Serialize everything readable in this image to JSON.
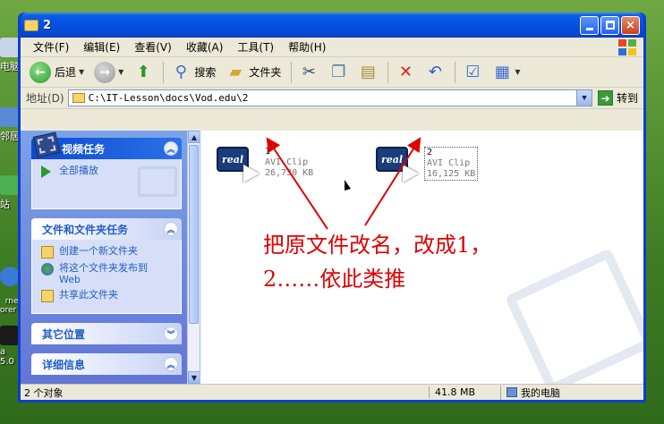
{
  "desktop": {
    "icons": [
      {
        "label": "电脑"
      },
      {
        "label": "邻居"
      },
      {
        "label": "站"
      },
      {
        "label": "rnet\norer"
      },
      {
        "label": "a 5.0"
      }
    ]
  },
  "window": {
    "title": "2",
    "controls": {
      "minimize": "minimize",
      "maximize": "maximize",
      "close": "×"
    }
  },
  "menubar": {
    "items": [
      "文件(F)",
      "编辑(E)",
      "查看(V)",
      "收藏(A)",
      "工具(T)",
      "帮助(H)"
    ]
  },
  "toolbar": {
    "back": "后退",
    "search": "搜索",
    "folders": "文件夹"
  },
  "addressbar": {
    "label": "地址(D)",
    "path": "C:\\IT-Lesson\\docs\\Vod.edu\\2",
    "go": "转到"
  },
  "taskpane": {
    "video_tasks": {
      "title": "视频任务",
      "items": [
        "全部播放"
      ]
    },
    "file_tasks": {
      "title": "文件和文件夹任务",
      "items": [
        "创建一个新文件夹",
        "将这个文件夹发布到\nWeb",
        "共享此文件夹"
      ]
    },
    "other_places": {
      "title": "其它位置"
    },
    "details": {
      "title": "详细信息"
    }
  },
  "files": [
    {
      "name": "1",
      "type": "AVI Clip",
      "size": "26,730 KB",
      "icon_text": "real"
    },
    {
      "name": "2",
      "type": "AVI Clip",
      "size": "16,125 KB",
      "icon_text": "real"
    }
  ],
  "annotation": {
    "line1": "把原文件改名，改成1，",
    "line2": "2……依此类推"
  },
  "statusbar": {
    "count": "2 个对象",
    "size": "41.8 MB",
    "location": "我的电脑"
  },
  "colors": {
    "title_blue": "#0550e0",
    "annotation_red": "#e00000",
    "link_blue": "#215dc6"
  }
}
